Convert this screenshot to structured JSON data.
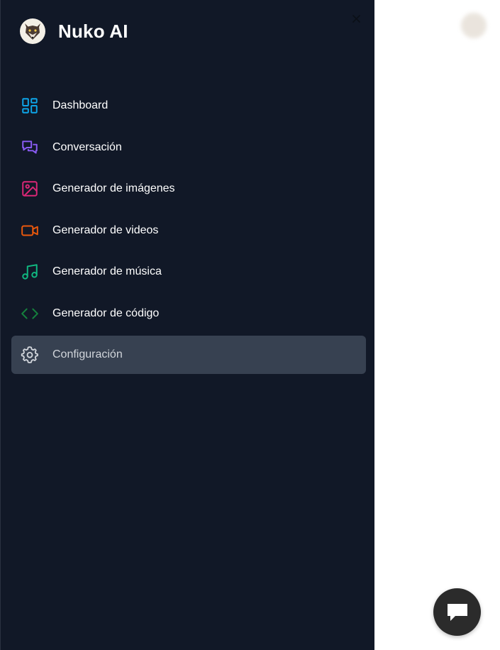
{
  "brand": {
    "title": "Nuko AI"
  },
  "sidebar": {
    "items": [
      {
        "label": "Dashboard",
        "icon": "dashboard-icon",
        "color": "#0ea5e9"
      },
      {
        "label": "Conversación",
        "icon": "chat-bubbles-icon",
        "color": "#8b5cf6"
      },
      {
        "label": "Generador de imágenes",
        "icon": "image-icon",
        "color": "#db2777"
      },
      {
        "label": "Generador de videos",
        "icon": "video-icon",
        "color": "#ea580c"
      },
      {
        "label": "Generador de música",
        "icon": "music-icon",
        "color": "#10b981"
      },
      {
        "label": "Generador de código",
        "icon": "code-icon",
        "color": "#15803d"
      },
      {
        "label": "Configuración",
        "icon": "gear-icon",
        "color": "#d1d5db",
        "active": true
      }
    ]
  },
  "colors": {
    "sidebar_bg": "#111827",
    "active_bg": "#374151"
  }
}
